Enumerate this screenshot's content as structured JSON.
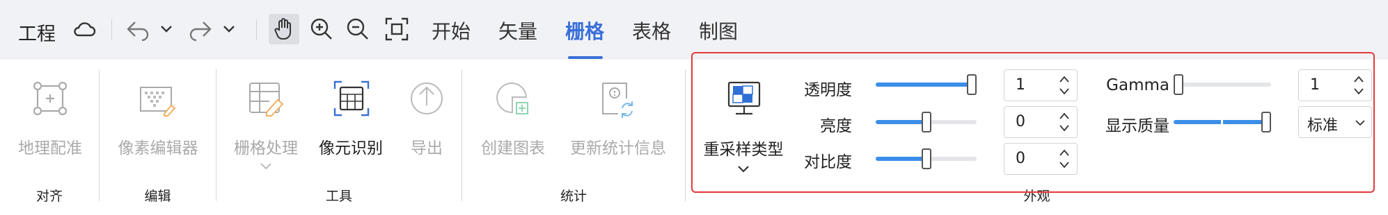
{
  "topbar": {
    "project_label": "工程",
    "tabs": [
      {
        "label": "开始",
        "active": false
      },
      {
        "label": "矢量",
        "active": false
      },
      {
        "label": "栅格",
        "active": true
      },
      {
        "label": "表格",
        "active": false
      },
      {
        "label": "制图",
        "active": false
      }
    ],
    "icons": [
      "cloud-icon",
      "undo-icon",
      "undo-dropdown-icon",
      "redo-icon",
      "redo-dropdown-icon",
      "pan-hand-icon",
      "zoom-in-icon",
      "zoom-out-icon",
      "fit-extent-icon"
    ]
  },
  "ribbon": {
    "groups": {
      "align": {
        "label": "对齐",
        "buttons": [
          {
            "label": "地理配准",
            "enabled": false,
            "icon": "georeference-icon"
          }
        ]
      },
      "edit": {
        "label": "编辑",
        "buttons": [
          {
            "label": "像素编辑器",
            "enabled": false,
            "icon": "pixel-editor-icon"
          }
        ]
      },
      "tools": {
        "label": "工具",
        "buttons": [
          {
            "label": "栅格处理",
            "enabled": false,
            "icon": "raster-processing-icon",
            "has_dropdown": true
          },
          {
            "label": "像元识别",
            "enabled": true,
            "icon": "pixel-identify-icon"
          },
          {
            "label": "导出",
            "enabled": false,
            "icon": "export-icon"
          }
        ]
      },
      "stats": {
        "label": "统计",
        "buttons": [
          {
            "label": "创建图表",
            "enabled": false,
            "icon": "create-chart-icon"
          },
          {
            "label": "更新统计信息",
            "enabled": false,
            "icon": "update-statistics-icon"
          }
        ]
      },
      "appearance": {
        "label": "外观",
        "resample": {
          "label": "重采样类型",
          "icon": "resample-type-icon",
          "has_dropdown": true
        },
        "transparency": {
          "label": "透明度",
          "value": "1",
          "level": 1.0
        },
        "brightness": {
          "label": "亮度",
          "value": "0",
          "level": 0.5
        },
        "contrast": {
          "label": "对比度",
          "value": "0",
          "level": 0.5
        },
        "gamma": {
          "label": "Gamma",
          "value": "1",
          "level": 0.0
        },
        "display_quality": {
          "label": "显示质量",
          "selected": "标准",
          "level": 1.0
        }
      }
    }
  },
  "colors": {
    "accent": "#3a6fd8",
    "slider_fill": "#3b8ee8",
    "highlight": "#e23a3a",
    "disabled_text": "#aaaaaa"
  }
}
